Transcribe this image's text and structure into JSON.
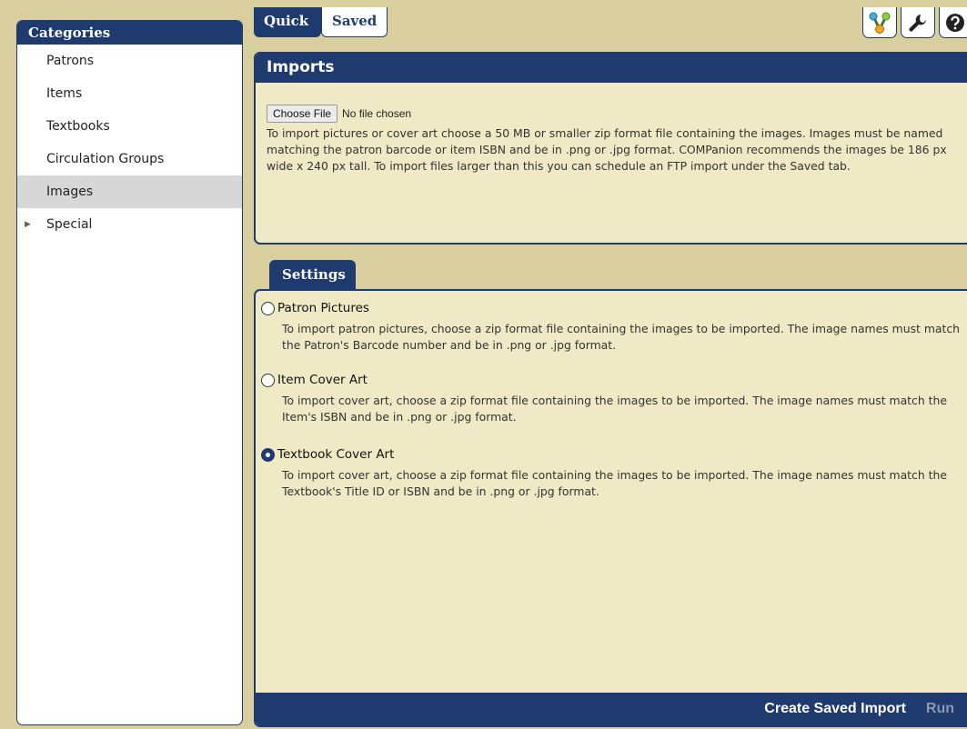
{
  "sidebar": {
    "title": "Categories",
    "items": [
      {
        "label": "Patrons"
      },
      {
        "label": "Items"
      },
      {
        "label": "Textbooks"
      },
      {
        "label": "Circulation Groups"
      },
      {
        "label": "Images"
      },
      {
        "label": "Special"
      }
    ],
    "selected": "Images"
  },
  "tabs": {
    "quick": "Quick",
    "saved": "Saved"
  },
  "toolbar": {
    "icons": [
      "flow-icon",
      "wrench-icon",
      "help-icon"
    ]
  },
  "imports": {
    "title": "Imports",
    "choose_file_label": "Choose File",
    "file_status": "No file chosen",
    "description": "To import pictures or cover art choose a 50 MB or smaller zip format file containing the images. Images must be named matching the patron barcode or item ISBN and be in .png or .jpg format. COMPanion recommends the images be 186 px wide x 240 px tall. To import files larger than this you can schedule an FTP import under the Saved tab."
  },
  "settings": {
    "tab_label": "Settings",
    "options": [
      {
        "label": "Patron Pictures",
        "checked": false,
        "description": "To import patron pictures, choose a zip format file containing the images to be imported. The image names must match the Patron's Barcode number and be in .png or .jpg format."
      },
      {
        "label": "Item Cover Art",
        "checked": false,
        "description": "To import cover art, choose a zip format file containing the images to be imported. The image names must match the Item's ISBN and be in .png or .jpg format."
      },
      {
        "label": "Textbook Cover Art",
        "checked": true,
        "description": "To import cover art, choose a zip format file containing the images to be imported. The image names must match the Textbook's Title ID or ISBN and be in .png or .jpg format."
      }
    ]
  },
  "footer": {
    "create_saved_import": "Create Saved Import",
    "run": "Run"
  },
  "colors": {
    "navy": "#1f3a6e",
    "background": "#d9ce9d",
    "panel": "#efe9c6"
  }
}
